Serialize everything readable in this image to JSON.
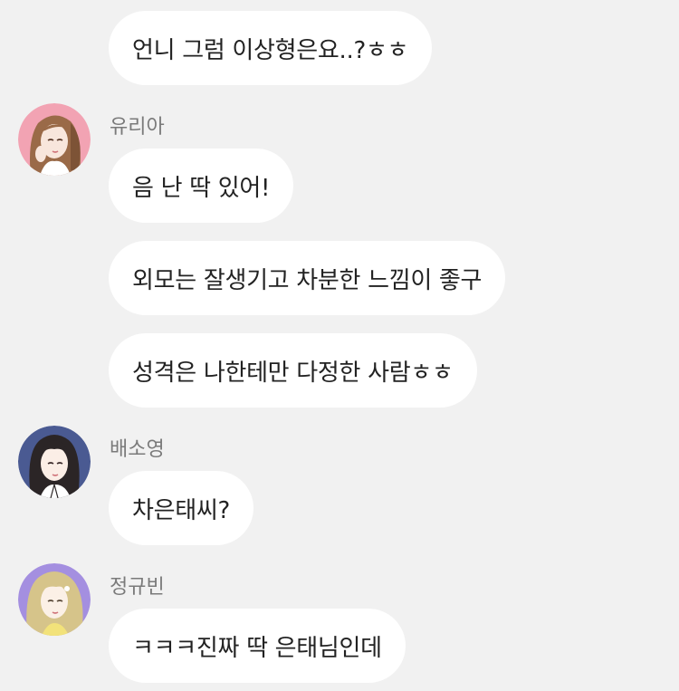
{
  "messages": [
    {
      "text": "언니 그럼 이상형은요..?ㅎㅎ"
    },
    {
      "sender": "유리아",
      "text": "음 난 딱 있어!"
    },
    {
      "text": "외모는 잘생기고 차분한 느낌이 좋구"
    },
    {
      "text": "성격은 나한테만 다정한 사람ㅎㅎ"
    },
    {
      "sender": "배소영",
      "text": "차은태씨?"
    },
    {
      "sender": "정규빈",
      "text": "ㅋㅋㅋ진짜 딱 은태님인데"
    }
  ],
  "avatars": {
    "yuria": {
      "icon": "avatar-yuria-icon",
      "bg": "#f2a3b3",
      "hair": "#9a6a48"
    },
    "soyoung": {
      "icon": "avatar-soyoung-icon",
      "bg": "#4a5a92",
      "hair": "#2b2526"
    },
    "gyubin": {
      "icon": "avatar-gyubin-icon",
      "bg": "#a48fe0",
      "hair": "#d6c48a"
    }
  },
  "colors": {
    "background": "#f1f1f1",
    "bubble": "#ffffff",
    "text": "#222222",
    "sender": "#7a7a7a"
  }
}
